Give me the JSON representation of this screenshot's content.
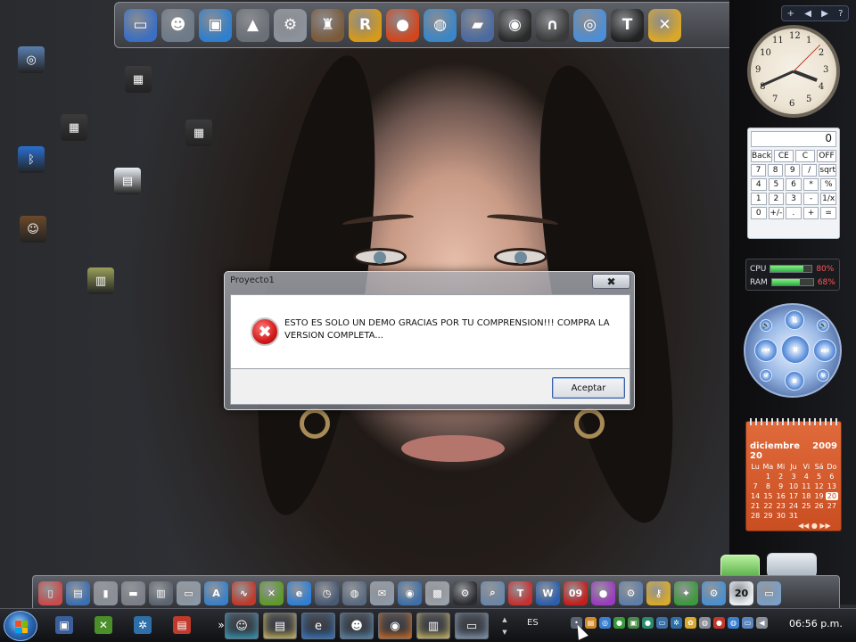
{
  "dialog": {
    "title": "Proyecto1",
    "close_label": "✖",
    "icon_glyph": "✖",
    "message": "ESTO ES SOLO UN DEMO GRACIAS POR TU COMPRENSION!!! COMPRA LA VERSION COMPLETA...",
    "ok_label": "Aceptar"
  },
  "sidebar": {
    "controls": [
      "+",
      "◀",
      "▶",
      "?"
    ]
  },
  "clock": {
    "numerals": [
      "12",
      "1",
      "2",
      "3",
      "4",
      "5",
      "6",
      "7",
      "8",
      "9",
      "10",
      "11"
    ],
    "hour_deg": 111,
    "minute_deg": 246,
    "second_deg": 45
  },
  "calculator": {
    "display": "0",
    "keys": [
      [
        "Back",
        "CE",
        "C",
        "OFF"
      ],
      [
        "7",
        "8",
        "9",
        "/",
        "sqrt"
      ],
      [
        "4",
        "5",
        "6",
        "*",
        "%"
      ],
      [
        "1",
        "2",
        "3",
        "-",
        "1/x"
      ],
      [
        "0",
        "+/-",
        ".",
        "+",
        "="
      ]
    ]
  },
  "meter": {
    "cpu_label": "CPU",
    "cpu_percent": "80%",
    "cpu_value": 0.8,
    "ram_label": "RAM",
    "ram_percent": "68%",
    "ram_value": 0.68
  },
  "media": {
    "buttons": {
      "top": "⇅",
      "left": "⏮",
      "center": "⏸",
      "right": "⏭",
      "bottom": "⏹",
      "tl": "🔉",
      "tr": "🔊",
      "bl": "↺",
      "br": "↻"
    }
  },
  "calendar": {
    "month": "diciembre 20",
    "year": "2009",
    "weekdays": [
      "Lu",
      "Ma",
      "Mi",
      "Ju",
      "Vi",
      "Sá",
      "Do"
    ],
    "leading_blanks": 0,
    "days": [
      "",
      "1",
      "2",
      "3",
      "4",
      "5",
      "6",
      "7",
      "8",
      "9",
      "10",
      "11",
      "12",
      "13",
      "14",
      "15",
      "16",
      "17",
      "18",
      "19",
      "20",
      "21",
      "22",
      "23",
      "24",
      "25",
      "26",
      "27",
      "28",
      "29",
      "30",
      "31"
    ],
    "today": "20",
    "nav": "◀◀ ● ▶▶"
  },
  "top_dock": {
    "icons": [
      {
        "name": "monitor-icon",
        "glyph": "▭",
        "color": "#3a6fc4"
      },
      {
        "name": "messenger-users-icon",
        "glyph": "☻",
        "color": "#6c7a89"
      },
      {
        "name": "computer-screen-icon",
        "glyph": "▣",
        "color": "#2f7fcf"
      },
      {
        "name": "wizard-hat-icon",
        "glyph": "▲",
        "color": "#6a7077"
      },
      {
        "name": "settings-gear-icon",
        "glyph": "⚙",
        "color": "#8d939c"
      },
      {
        "name": "gta-game-icon",
        "glyph": "♜",
        "color": "#7b5a3a"
      },
      {
        "name": "rockstar-icon",
        "glyph": "R",
        "color": "#d59a1b"
      },
      {
        "name": "fireball-icon",
        "glyph": "●",
        "color": "#d2461d"
      },
      {
        "name": "globe-icon",
        "glyph": "◍",
        "color": "#3a86c9"
      },
      {
        "name": "race-car-icon",
        "glyph": "▰",
        "color": "#4a6aa0"
      },
      {
        "name": "alien-icon",
        "glyph": "◉",
        "color": "#2a2a2a"
      },
      {
        "name": "headphones-icon",
        "glyph": "∩",
        "color": "#3a3a3a"
      },
      {
        "name": "internet-globe-icon",
        "glyph": "◎",
        "color": "#4c8fd8"
      },
      {
        "name": "tshirt-icon",
        "glyph": "T",
        "color": "#222"
      },
      {
        "name": "tools-icon",
        "glyph": "✕",
        "color": "#d9a72a"
      }
    ]
  },
  "desktop_icons": [
    {
      "name": "cd-disc-desktop-icon",
      "glyph": "◎",
      "color": "#5a7fb0"
    },
    {
      "name": "film-desktop-icon",
      "glyph": "▦",
      "color": "#3b3b3b"
    },
    {
      "name": "film-desktop-icon",
      "glyph": "▦",
      "color": "#3b3b3b"
    },
    {
      "name": "film-desktop-icon",
      "glyph": "▦",
      "color": "#3b3b3b"
    },
    {
      "name": "bluetooth-desktop-icon",
      "glyph": "ᛒ",
      "color": "#2a6fd1"
    },
    {
      "name": "document-desktop-icon",
      "glyph": "▤",
      "color": "#e9eef3"
    },
    {
      "name": "game-shortcut-desktop-icon",
      "glyph": "☺",
      "color": "#6b4a2a"
    },
    {
      "name": "video-file-desktop-icon",
      "glyph": "▥",
      "color": "#9aa05a"
    }
  ],
  "bottom_dock": {
    "icons": [
      {
        "name": "notepad-icon",
        "glyph": "▯",
        "color": "#c94b4b"
      },
      {
        "name": "media-player-icon",
        "glyph": "▤",
        "color": "#3c6fb1"
      },
      {
        "name": "files-icon",
        "glyph": "▮",
        "color": "#8a9099"
      },
      {
        "name": "folder-icon",
        "glyph": "▬",
        "color": "#7a7f88"
      },
      {
        "name": "screens-icon",
        "glyph": "▥",
        "color": "#5b6470"
      },
      {
        "name": "drive-icon",
        "glyph": "▭",
        "color": "#8b98a6"
      },
      {
        "name": "acrobat-icon",
        "glyph": "A",
        "color": "#3a80c9"
      },
      {
        "name": "audio-wave-icon",
        "glyph": "∿",
        "color": "#c0392b"
      },
      {
        "name": "xbox-icon",
        "glyph": "✕",
        "color": "#5d9a2a"
      },
      {
        "name": "ie-icon",
        "glyph": "e",
        "color": "#2f7fd5"
      },
      {
        "name": "clock-icon",
        "glyph": "◷",
        "color": "#4a5a74"
      },
      {
        "name": "satellite-icon",
        "glyph": "◍",
        "color": "#5a6a80"
      },
      {
        "name": "mail-icon",
        "glyph": "✉",
        "color": "#8e9aa8"
      },
      {
        "name": "network-icon",
        "glyph": "◉",
        "color": "#3e6fa8"
      },
      {
        "name": "image-viewer-icon",
        "glyph": "▩",
        "color": "#9aa0a8"
      },
      {
        "name": "dark-gear-icon",
        "glyph": "⚙",
        "color": "#2a2c30"
      },
      {
        "name": "magnifier-icon",
        "glyph": "⌕",
        "color": "#6b86a8"
      },
      {
        "name": "teamviewer-icon",
        "glyph": "T",
        "color": "#c63030"
      },
      {
        "name": "word-icon",
        "glyph": "W",
        "color": "#2b5fae"
      },
      {
        "name": "nine-channel-icon",
        "glyph": "09",
        "color": "#c41f1f"
      },
      {
        "name": "purple-orb-icon",
        "glyph": "●",
        "color": "#9b3bc0"
      },
      {
        "name": "system-gear-icon",
        "glyph": "⚙",
        "color": "#5d7ea8"
      },
      {
        "name": "key-icon",
        "glyph": "⚷",
        "color": "#d8a92b"
      },
      {
        "name": "puzzle-icon",
        "glyph": "✦",
        "color": "#3b9a3b"
      },
      {
        "name": "network-gear-icon",
        "glyph": "⚙",
        "color": "#4a90d0"
      },
      {
        "name": "calendar-20-icon",
        "glyph": "20",
        "color": "#e9eef3"
      },
      {
        "name": "window-icon",
        "glyph": "▭",
        "color": "#7aa0c8"
      }
    ]
  },
  "taskbar": {
    "quicklaunch": [
      {
        "name": "show-desktop-icon",
        "glyph": "▣",
        "color": "#3b5f9a"
      },
      {
        "name": "xbox-quicklaunch-icon",
        "glyph": "✕",
        "color": "#4a8f2a"
      },
      {
        "name": "network-quicklaunch-icon",
        "glyph": "✲",
        "color": "#2e6fa8"
      },
      {
        "name": "pdf-quicklaunch-icon",
        "glyph": "▤",
        "color": "#c0392b"
      },
      {
        "name": "overflow-chevron-icon",
        "glyph": "»",
        "color": "transparent"
      }
    ],
    "tasks": [
      {
        "name": "task-messenger",
        "glyph": "☺",
        "color": "#3aa2c4"
      },
      {
        "name": "task-notes",
        "glyph": "▤",
        "color": "#d5c26a"
      },
      {
        "name": "task-internet-explorer",
        "glyph": "e",
        "color": "#3a80d0"
      },
      {
        "name": "task-users",
        "glyph": "☻",
        "color": "#5e8fb0"
      },
      {
        "name": "task-firefox",
        "glyph": "◉",
        "color": "#d8742a"
      },
      {
        "name": "task-notes-2",
        "glyph": "▥",
        "color": "#d5c26a"
      },
      {
        "name": "task-window",
        "glyph": "▭",
        "color": "#8aa0b8"
      }
    ],
    "scroll_up": "▲",
    "scroll_down": "▼",
    "language": "ES",
    "tray": [
      {
        "name": "tray-icon-1",
        "glyph": "•",
        "color": "#5a6472"
      },
      {
        "name": "tray-icon-2",
        "glyph": "▤",
        "color": "#d08a2a"
      },
      {
        "name": "tray-icon-3",
        "glyph": "◎",
        "color": "#3a7fd0"
      },
      {
        "name": "tray-icon-4",
        "glyph": "●",
        "color": "#3a9a3a"
      },
      {
        "name": "tray-icon-5",
        "glyph": "▣",
        "color": "#4a8a4a"
      },
      {
        "name": "tray-icon-6",
        "glyph": "●",
        "color": "#2a8a6a"
      },
      {
        "name": "tray-icon-7",
        "glyph": "▭",
        "color": "#3a6fa8"
      },
      {
        "name": "tray-icon-8",
        "glyph": "✲",
        "color": "#2e6fa8"
      },
      {
        "name": "tray-icon-9",
        "glyph": "✿",
        "color": "#d8a92b"
      },
      {
        "name": "tray-icon-10",
        "glyph": "◍",
        "color": "#8a8f96"
      },
      {
        "name": "tray-icon-11",
        "glyph": "●",
        "color": "#c0392b"
      },
      {
        "name": "tray-icon-12",
        "glyph": "◍",
        "color": "#3a7fd0"
      },
      {
        "name": "network-tray-icon",
        "glyph": "▭",
        "color": "#5a86c0"
      },
      {
        "name": "volume-tray-icon",
        "glyph": "◀",
        "color": "#8a9099"
      }
    ],
    "time": "06:56 p.m."
  }
}
